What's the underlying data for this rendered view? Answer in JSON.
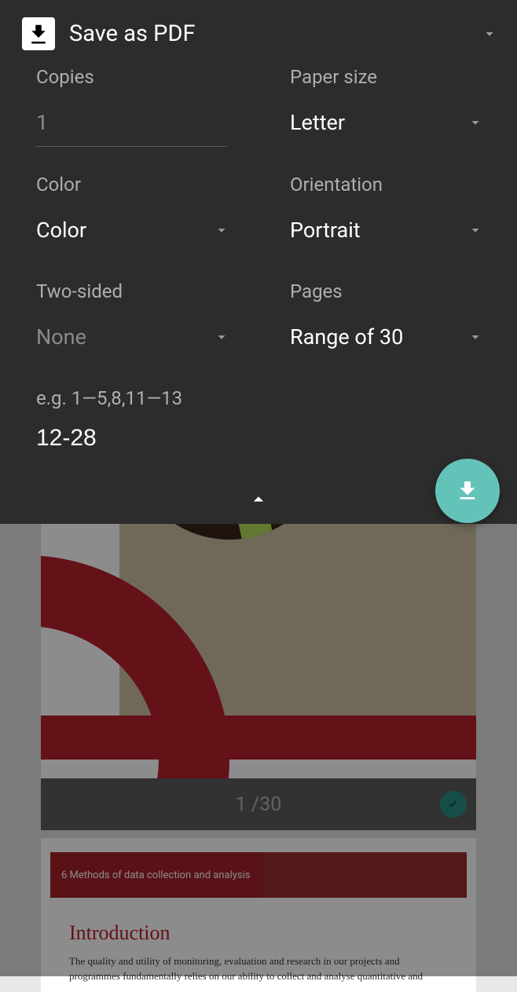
{
  "header": {
    "title": "Save as PDF"
  },
  "settings": {
    "copies": {
      "label": "Copies",
      "value": "1"
    },
    "paperSize": {
      "label": "Paper size",
      "value": "Letter"
    },
    "color": {
      "label": "Color",
      "value": "Color"
    },
    "orientation": {
      "label": "Orientation",
      "value": "Portrait"
    },
    "twoSided": {
      "label": "Two-sided",
      "value": "None"
    },
    "pages": {
      "label": "Pages",
      "value": "Range of 30"
    },
    "range": {
      "hint": "e.g. 1—5,8,11—13",
      "value": "12-28"
    }
  },
  "preview": {
    "page1_counter": "1 /30",
    "page2": {
      "banner": "6 Methods of data collection and analysis",
      "introTitle": "Introduction",
      "introText": "The quality and utility of monitoring, evaluation and research in our projects and programmes fundamentally relies on our ability to collect and analyse quantitative and"
    }
  }
}
